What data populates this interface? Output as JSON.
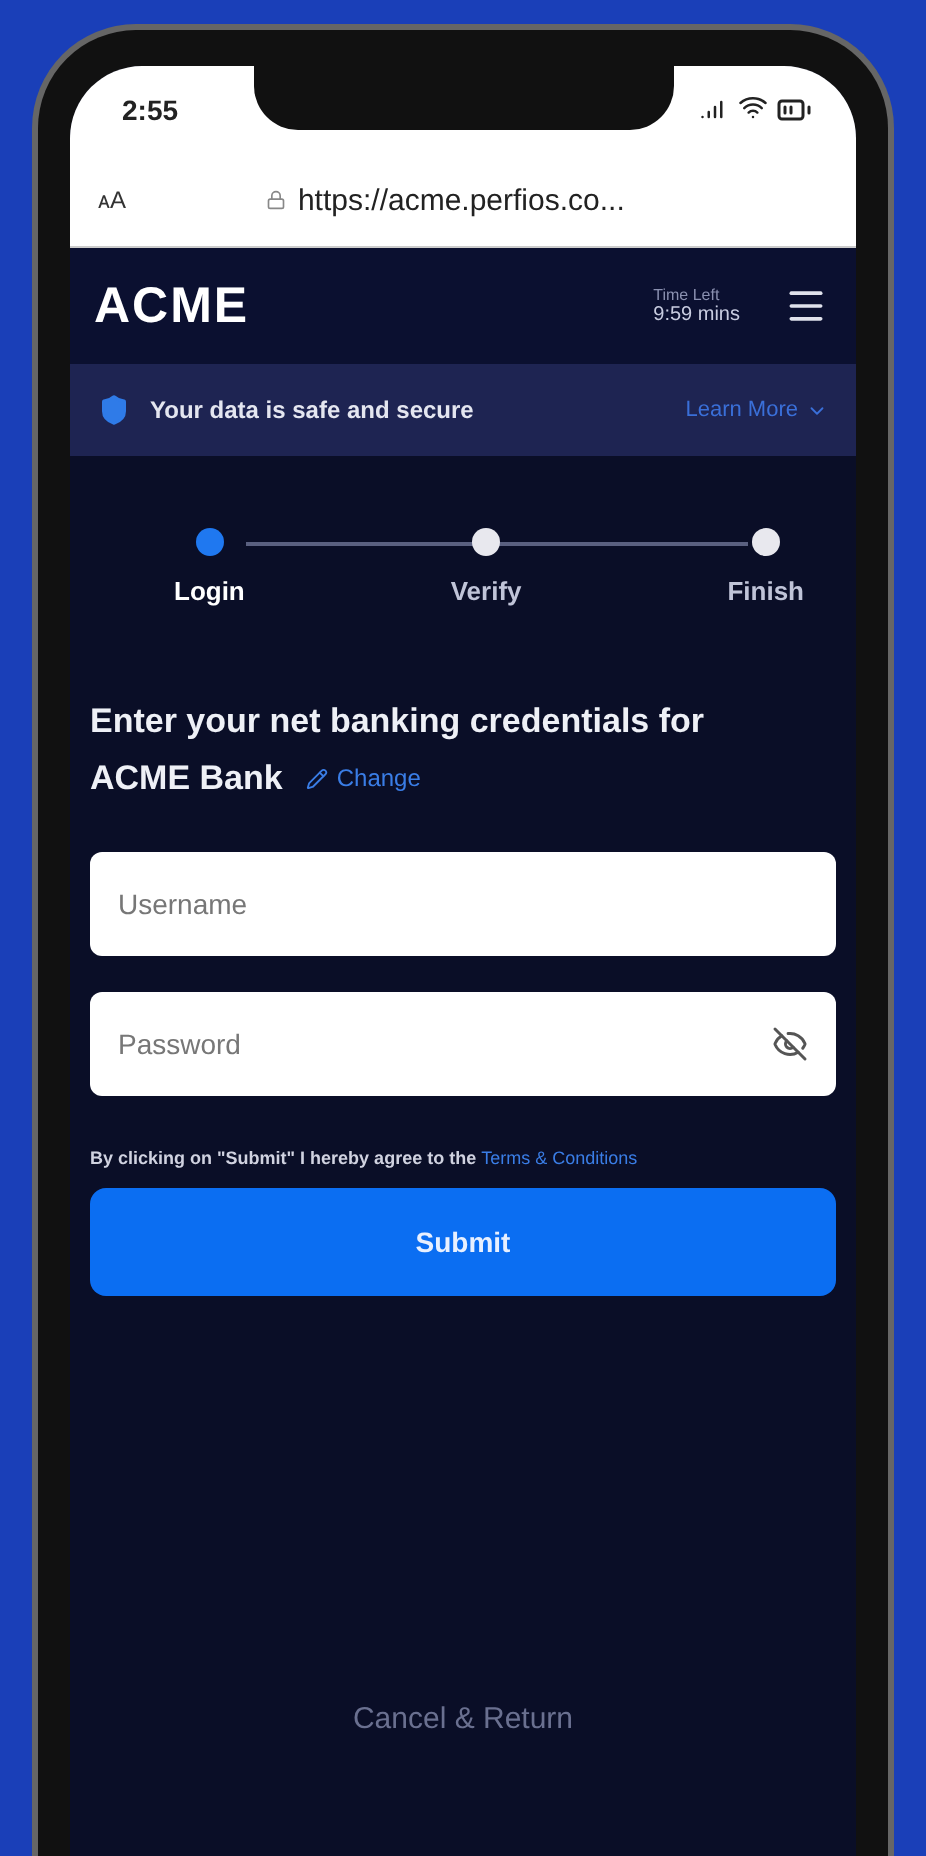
{
  "status_bar": {
    "time": "2:55"
  },
  "browser": {
    "text_size": "ᴀA",
    "url": "https://acme.perfios.co..."
  },
  "header": {
    "logo": "ACME",
    "timer_label": "Time Left",
    "timer_value": "9:59 mins"
  },
  "banner": {
    "text": "Your data is safe and secure",
    "link": "Learn More"
  },
  "steps": [
    {
      "label": "Login",
      "selected": true
    },
    {
      "label": "Verify",
      "selected": false
    },
    {
      "label": "Finish",
      "selected": false
    }
  ],
  "heading": "Enter your net banking credentials for ACME Bank",
  "change_link": "Change",
  "fields": [
    {
      "placeholder": "Username",
      "kind": "text"
    },
    {
      "placeholder": "Password",
      "kind": "password"
    }
  ],
  "terms": {
    "text": "By clicking on \"Submit\" I hereby agree to the",
    "link": "Terms & Conditions"
  },
  "submit": "Submit",
  "cancel": "Cancel & Return"
}
